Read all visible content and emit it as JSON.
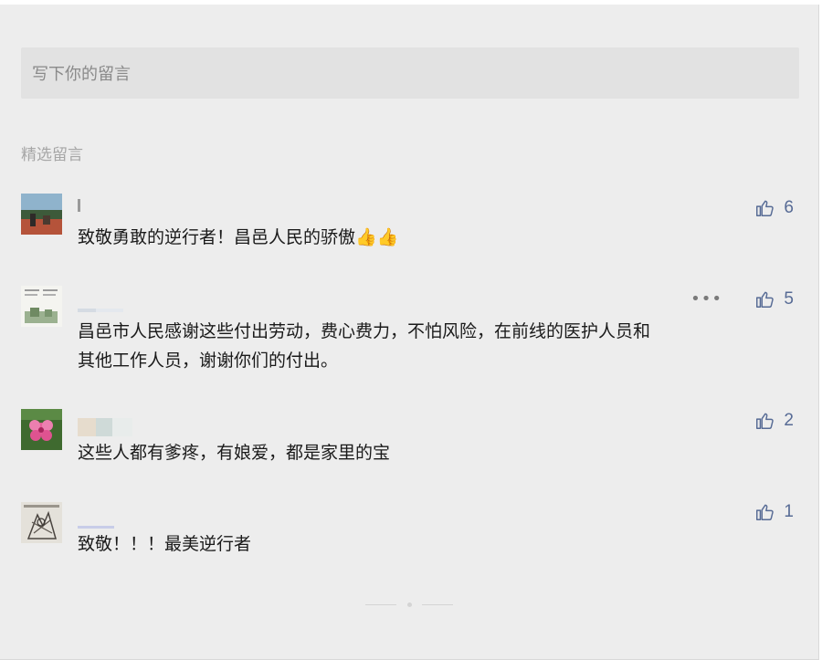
{
  "write_box": {
    "placeholder": "写下你的留言"
  },
  "section_label": "精选留言",
  "comments": [
    {
      "text": "致敬勇敢的逆行者！昌邑人民的骄傲👍👍",
      "likes": "6"
    },
    {
      "text_line1": "昌邑市人民感谢这些付出劳动，费心费力，不怕风险，在前线的医护人员和",
      "text_line2": "其他工作人员，谢谢你们的付出。",
      "likes": "5",
      "more": "•••"
    },
    {
      "text": "这些人都有爹疼，有娘爱，都是家里的宝",
      "likes": "2"
    },
    {
      "text": "致敬！！！最美逆行者",
      "likes": "1"
    }
  ],
  "colors": {
    "panel_bg": "#ededed",
    "like_blue": "#576b95",
    "text": "#1a1a1a",
    "muted": "#a6a6a6"
  },
  "icons": [
    "thumbs-up-icon",
    "more-dots-icon"
  ]
}
